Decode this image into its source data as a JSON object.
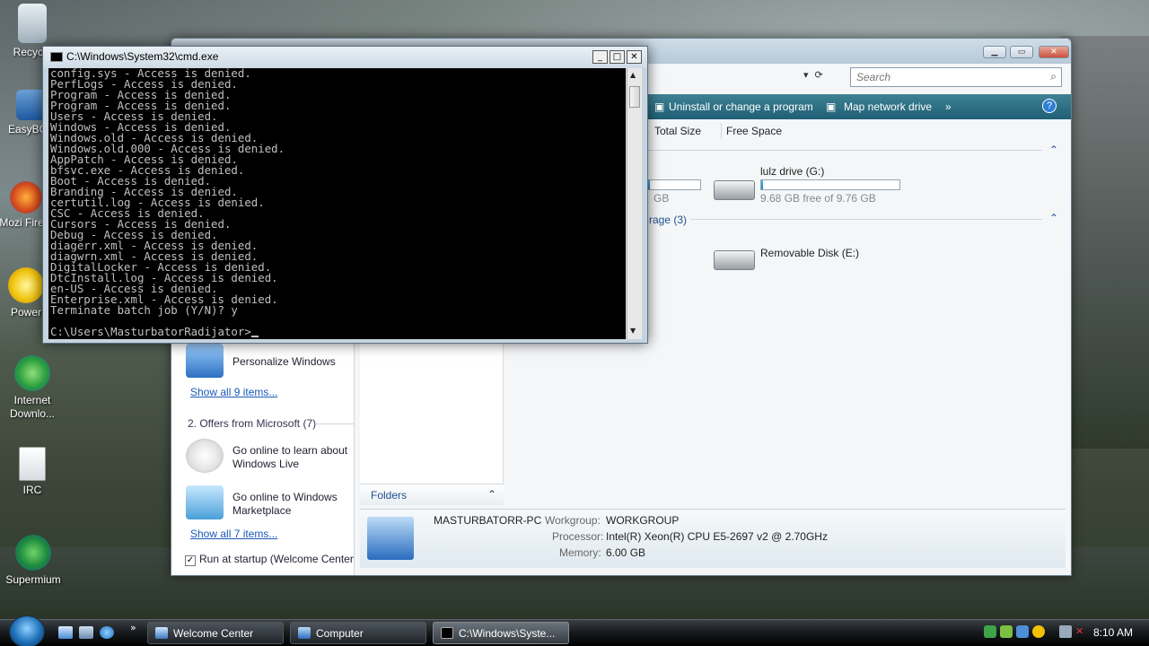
{
  "desktop": {
    "icons": [
      {
        "label": "Recycle",
        "name": "recycle-bin"
      },
      {
        "label": "EasyBCD",
        "name": "easybcd"
      },
      {
        "label": "Mozi Firefo",
        "name": "firefox"
      },
      {
        "label": "Power",
        "name": "power-dvd"
      },
      {
        "label": "Internet Downlo...",
        "name": "internet-download-manager"
      },
      {
        "label": "IRC",
        "name": "irc"
      },
      {
        "label": "Supermium",
        "name": "supermium"
      }
    ]
  },
  "cmd": {
    "title": "C:\\Windows\\System32\\cmd.exe",
    "lines": [
      "config.sys - Access is denied.",
      "PerfLogs - Access is denied.",
      "Program - Access is denied.",
      "Program - Access is denied.",
      "Users - Access is denied.",
      "Windows - Access is denied.",
      "Windows.old - Access is denied.",
      "Windows.old.000 - Access is denied.",
      "AppPatch - Access is denied.",
      "bfsvc.exe - Access is denied.",
      "Boot - Access is denied.",
      "Branding - Access is denied.",
      "certutil.log - Access is denied.",
      "CSC - Access is denied.",
      "Cursors - Access is denied.",
      "Debug - Access is denied.",
      "diagerr.xml - Access is denied.",
      "diagwrn.xml - Access is denied.",
      "DigitalLocker - Access is denied.",
      "DtcInstall.log - Access is denied.",
      "en-US - Access is denied.",
      "Enterprise.xml - Access is denied.",
      "Terminate batch job (Y/N)? y",
      "",
      "C:\\Users\\MasturbatorRadijator>"
    ]
  },
  "explorer": {
    "search_placeholder": "Search",
    "toolbar": {
      "uninstall": "Uninstall or change a program",
      "map_drive": "Map network drive",
      "more": "»"
    },
    "columns": {
      "total_size": "Total Size",
      "free_space": "Free Space"
    },
    "drives": {
      "partial_gb": "GB",
      "lulz_name": "lulz drive (G:)",
      "lulz_free": "9.68 GB free of 9.76 GB",
      "lulz_used_fraction": 0.01,
      "removable_group": "rage (3)",
      "removable_name": "Removable Disk (E:)"
    },
    "left_pane": {
      "personalize": "Personalize Windows",
      "show_all_9": "Show all 9 items...",
      "offers_header": "2. Offers from Microsoft (7)",
      "windows_live": "Go online to learn about Windows Live",
      "marketplace": "Go online to Windows Marketplace",
      "show_all_7": "Show all 7 items...",
      "run_startup": "Run at startup (Welcome Center"
    },
    "folders_label": "Folders",
    "details": {
      "computer_name": "MASTURBATORR-PC",
      "workgroup_label": "Workgroup:",
      "workgroup": "WORKGROUP",
      "processor_label": "Processor:",
      "processor": "Intel(R) Xeon(R) CPU E5-2697 v2 @ 2.70GHz",
      "memory_label": "Memory:",
      "memory": "6.00 GB"
    }
  },
  "taskbar": {
    "tasks": [
      {
        "label": "Welcome Center"
      },
      {
        "label": "Computer"
      },
      {
        "label": "C:\\Windows\\Syste..."
      }
    ],
    "clock": "8:10 AM"
  }
}
